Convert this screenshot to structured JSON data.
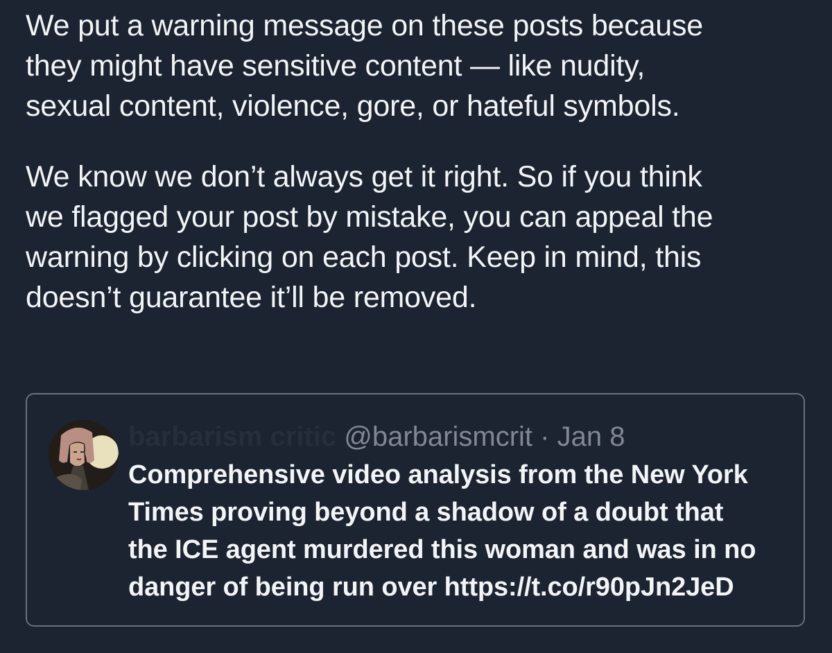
{
  "notice": {
    "paragraph_1_lines": [
      "We put a warning message on these posts because",
      "they might have sensitive content — like nudity,",
      "sexual content, violence, gore, or hateful symbols."
    ],
    "paragraph_2_lines": [
      "We know we don’t always get it right. So if you think",
      "we flagged your post by mistake, you can appeal the",
      "warning by clicking on each post. Keep in mind, this",
      "doesn’t guarantee it’ll be removed."
    ]
  },
  "quoted_post": {
    "display_name": "barbarism critic",
    "handle": "@barbarismcrit",
    "separator": "·",
    "date": "Jan 8",
    "text_lines": [
      "Comprehensive video analysis from the New York",
      "Times proving beyond a shadow of a doubt that",
      "the ICE agent murdered this woman and was in no",
      "danger of being run over https://t.co/r90pJn2JeD"
    ],
    "avatar_icon": "profile-avatar-icon"
  },
  "colors": {
    "background": "#1c2431",
    "text": "#f2f4f7",
    "muted": "#818894",
    "card_border": "#6a717c"
  }
}
